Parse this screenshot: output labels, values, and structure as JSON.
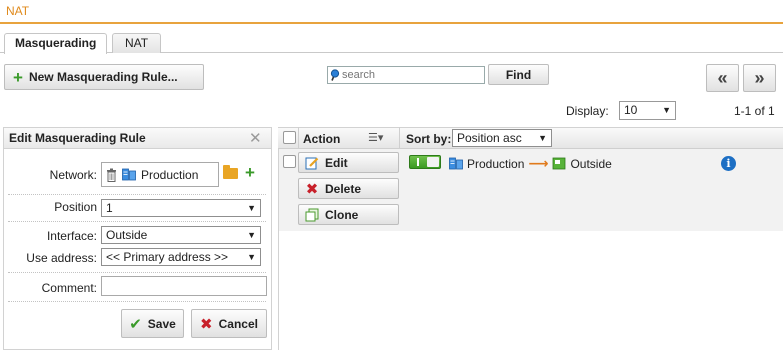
{
  "page": {
    "title": "NAT"
  },
  "tabs": [
    {
      "label": "Masquerading"
    },
    {
      "label": "NAT"
    }
  ],
  "toolbar": {
    "new_rule_label": "New Masquerading Rule...",
    "search_placeholder": "search",
    "find_label": "Find",
    "first_page_glyph": "«",
    "next_page_glyph": "»"
  },
  "pagination": {
    "display_label": "Display:",
    "page_size": "10",
    "range_text": "1-1 of 1"
  },
  "edit_panel": {
    "title": "Edit Masquerading Rule",
    "network_label": "Network:",
    "network_value": "Production",
    "position_label": "Position",
    "position_value": "1",
    "interface_label": "Interface:",
    "interface_value": "Outside",
    "use_address_label": "Use address:",
    "use_address_value": "<< Primary address >>",
    "comment_label": "Comment:",
    "comment_value": "",
    "save_label": "Save",
    "cancel_label": "Cancel"
  },
  "table": {
    "action_header": "Action",
    "sort_label": "Sort by:",
    "sort_value": "Position asc",
    "rows": [
      {
        "edit_label": "Edit",
        "delete_label": "Delete",
        "clone_label": "Clone",
        "enabled": true,
        "network": "Production",
        "interface": "Outside"
      }
    ]
  },
  "colors": {
    "accent_orange": "#e08a1c",
    "green": "#3a9a2a",
    "red": "#c8202a",
    "info_blue": "#1d6fc4"
  }
}
